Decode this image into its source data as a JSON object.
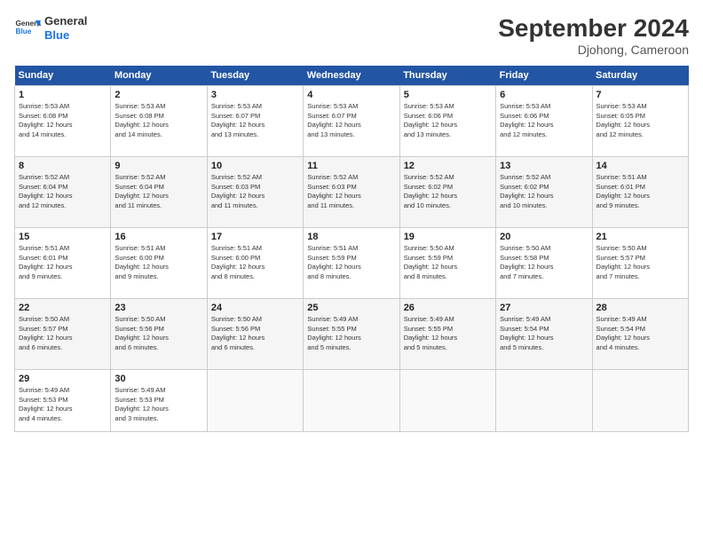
{
  "header": {
    "logo_line1": "General",
    "logo_line2": "Blue",
    "month_year": "September 2024",
    "location": "Djohong, Cameroon"
  },
  "weekdays": [
    "Sunday",
    "Monday",
    "Tuesday",
    "Wednesday",
    "Thursday",
    "Friday",
    "Saturday"
  ],
  "weeks": [
    [
      {
        "day": "1",
        "info": "Sunrise: 5:53 AM\nSunset: 6:08 PM\nDaylight: 12 hours\nand 14 minutes."
      },
      {
        "day": "2",
        "info": "Sunrise: 5:53 AM\nSunset: 6:08 PM\nDaylight: 12 hours\nand 14 minutes."
      },
      {
        "day": "3",
        "info": "Sunrise: 5:53 AM\nSunset: 6:07 PM\nDaylight: 12 hours\nand 13 minutes."
      },
      {
        "day": "4",
        "info": "Sunrise: 5:53 AM\nSunset: 6:07 PM\nDaylight: 12 hours\nand 13 minutes."
      },
      {
        "day": "5",
        "info": "Sunrise: 5:53 AM\nSunset: 6:06 PM\nDaylight: 12 hours\nand 13 minutes."
      },
      {
        "day": "6",
        "info": "Sunrise: 5:53 AM\nSunset: 6:06 PM\nDaylight: 12 hours\nand 12 minutes."
      },
      {
        "day": "7",
        "info": "Sunrise: 5:53 AM\nSunset: 6:05 PM\nDaylight: 12 hours\nand 12 minutes."
      }
    ],
    [
      {
        "day": "8",
        "info": "Sunrise: 5:52 AM\nSunset: 6:04 PM\nDaylight: 12 hours\nand 12 minutes."
      },
      {
        "day": "9",
        "info": "Sunrise: 5:52 AM\nSunset: 6:04 PM\nDaylight: 12 hours\nand 11 minutes."
      },
      {
        "day": "10",
        "info": "Sunrise: 5:52 AM\nSunset: 6:03 PM\nDaylight: 12 hours\nand 11 minutes."
      },
      {
        "day": "11",
        "info": "Sunrise: 5:52 AM\nSunset: 6:03 PM\nDaylight: 12 hours\nand 11 minutes."
      },
      {
        "day": "12",
        "info": "Sunrise: 5:52 AM\nSunset: 6:02 PM\nDaylight: 12 hours\nand 10 minutes."
      },
      {
        "day": "13",
        "info": "Sunrise: 5:52 AM\nSunset: 6:02 PM\nDaylight: 12 hours\nand 10 minutes."
      },
      {
        "day": "14",
        "info": "Sunrise: 5:51 AM\nSunset: 6:01 PM\nDaylight: 12 hours\nand 9 minutes."
      }
    ],
    [
      {
        "day": "15",
        "info": "Sunrise: 5:51 AM\nSunset: 6:01 PM\nDaylight: 12 hours\nand 9 minutes."
      },
      {
        "day": "16",
        "info": "Sunrise: 5:51 AM\nSunset: 6:00 PM\nDaylight: 12 hours\nand 9 minutes."
      },
      {
        "day": "17",
        "info": "Sunrise: 5:51 AM\nSunset: 6:00 PM\nDaylight: 12 hours\nand 8 minutes."
      },
      {
        "day": "18",
        "info": "Sunrise: 5:51 AM\nSunset: 5:59 PM\nDaylight: 12 hours\nand 8 minutes."
      },
      {
        "day": "19",
        "info": "Sunrise: 5:50 AM\nSunset: 5:59 PM\nDaylight: 12 hours\nand 8 minutes."
      },
      {
        "day": "20",
        "info": "Sunrise: 5:50 AM\nSunset: 5:58 PM\nDaylight: 12 hours\nand 7 minutes."
      },
      {
        "day": "21",
        "info": "Sunrise: 5:50 AM\nSunset: 5:57 PM\nDaylight: 12 hours\nand 7 minutes."
      }
    ],
    [
      {
        "day": "22",
        "info": "Sunrise: 5:50 AM\nSunset: 5:57 PM\nDaylight: 12 hours\nand 6 minutes."
      },
      {
        "day": "23",
        "info": "Sunrise: 5:50 AM\nSunset: 5:56 PM\nDaylight: 12 hours\nand 6 minutes."
      },
      {
        "day": "24",
        "info": "Sunrise: 5:50 AM\nSunset: 5:56 PM\nDaylight: 12 hours\nand 6 minutes."
      },
      {
        "day": "25",
        "info": "Sunrise: 5:49 AM\nSunset: 5:55 PM\nDaylight: 12 hours\nand 5 minutes."
      },
      {
        "day": "26",
        "info": "Sunrise: 5:49 AM\nSunset: 5:55 PM\nDaylight: 12 hours\nand 5 minutes."
      },
      {
        "day": "27",
        "info": "Sunrise: 5:49 AM\nSunset: 5:54 PM\nDaylight: 12 hours\nand 5 minutes."
      },
      {
        "day": "28",
        "info": "Sunrise: 5:49 AM\nSunset: 5:54 PM\nDaylight: 12 hours\nand 4 minutes."
      }
    ],
    [
      {
        "day": "29",
        "info": "Sunrise: 5:49 AM\nSunset: 5:53 PM\nDaylight: 12 hours\nand 4 minutes."
      },
      {
        "day": "30",
        "info": "Sunrise: 5:49 AM\nSunset: 5:53 PM\nDaylight: 12 hours\nand 3 minutes."
      },
      {
        "day": "",
        "info": ""
      },
      {
        "day": "",
        "info": ""
      },
      {
        "day": "",
        "info": ""
      },
      {
        "day": "",
        "info": ""
      },
      {
        "day": "",
        "info": ""
      }
    ]
  ]
}
